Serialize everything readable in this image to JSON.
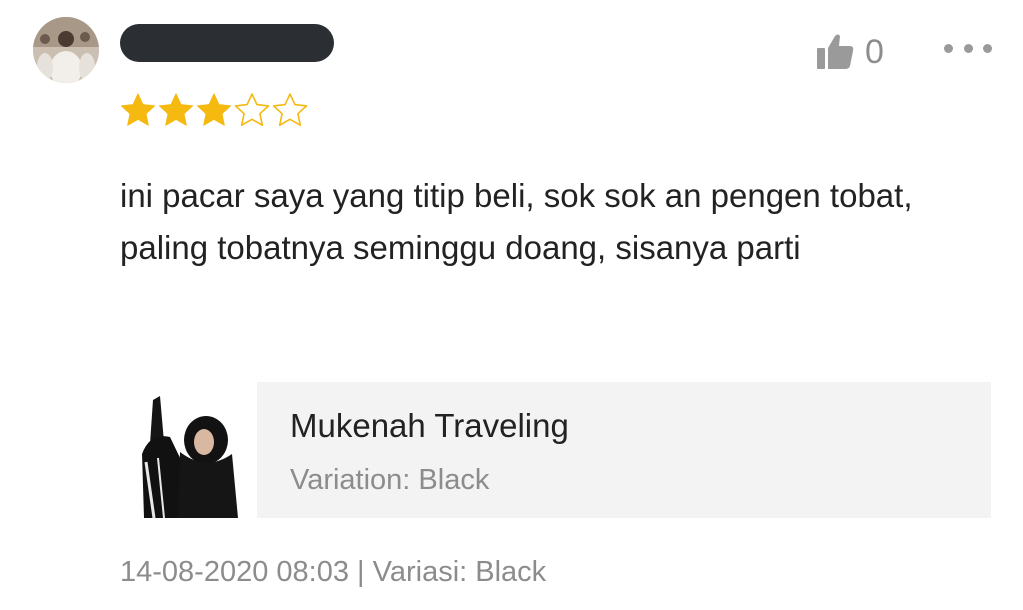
{
  "review": {
    "like_count": "0",
    "rating": 3,
    "rating_max": 5,
    "text": "ini pacar saya yang titip beli, sok sok an pengen tobat, paling tobatnya seminggu doang, sisanya parti"
  },
  "product": {
    "name": "Mukenah Traveling",
    "variation": "Variation: Black"
  },
  "meta": {
    "datetime": "14-08-2020 08:03",
    "separator": "|",
    "variation": "Variasi: Black"
  },
  "colors": {
    "star_filled": "#f5b90f",
    "star_empty_stroke": "#f5b90f",
    "muted_text": "#8c8c8c",
    "card_bg": "#f3f3f3",
    "redaction": "#2b2f33"
  },
  "icons": {
    "like": "thumbs-up-icon",
    "more": "more-dots-icon",
    "star": "star-icon"
  }
}
